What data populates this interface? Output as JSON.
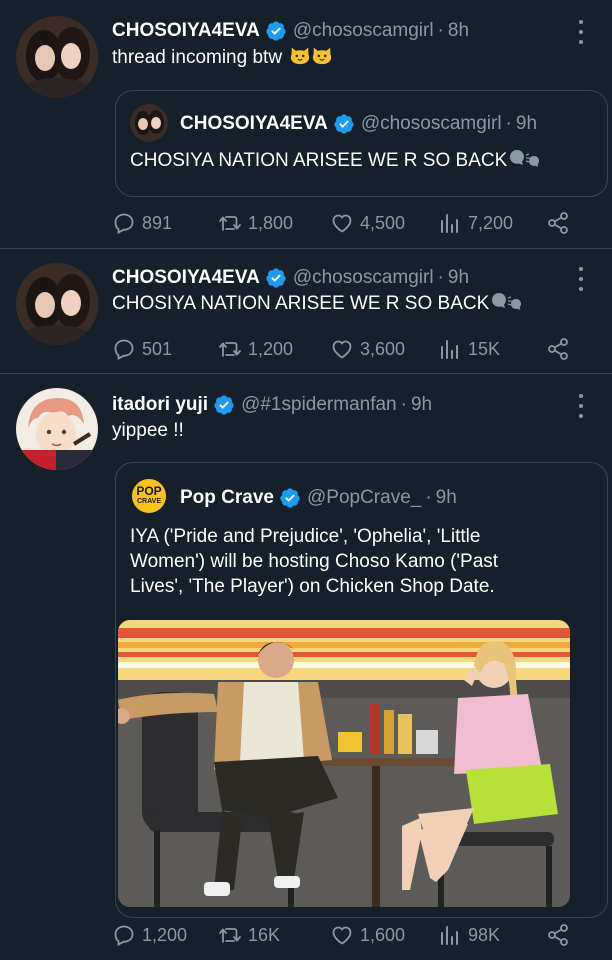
{
  "tweets": [
    {
      "name": "CHOSOIYA4EVA",
      "handle": "@chososcamgirl",
      "sep": "·",
      "time": "8h",
      "text": "thread incoming btw",
      "quote": {
        "name": "CHOSOIYA4EVA",
        "handle": "@chososcamgirl",
        "time": "9h",
        "text": "CHOSIYA NATION ARISEE WE R SO BACK"
      },
      "stats": {
        "replies": "891",
        "retweets": "1,800",
        "likes": "4,500",
        "views": "7,200"
      }
    },
    {
      "name": "CHOSOIYA4EVA",
      "handle": "@chososcamgirl",
      "sep": "·",
      "time": "9h",
      "text": "CHOSIYA NATION ARISEE WE R SO BACK",
      "stats": {
        "replies": "501",
        "retweets": "1,200",
        "likes": "3,600",
        "views": "15K"
      }
    },
    {
      "name": "itadori yuji",
      "handle": "@#1spidermanfan",
      "sep": "·",
      "time": "9h",
      "text": "yippee !!",
      "quote": {
        "name": "Pop Crave",
        "handle": "@PopCrave_",
        "time": "9h",
        "logo_line1": "POP",
        "logo_line2": "CRAVE",
        "text_line1": "IYA ('Pride and Prejudice', 'Ophelia', 'Little",
        "text_line2": "Women') will be hosting Choso Kamo ('Past",
        "text_line3": "Lives', 'The Player') on Chicken Shop Date."
      },
      "stats": {
        "replies": "1,200",
        "retweets": "16K",
        "likes": "1,600",
        "views": "98K"
      }
    }
  ],
  "colors": {
    "background": "#15202b",
    "border": "#38444d",
    "muted": "#8899a6",
    "verified": "#1d9bf0",
    "text": "#ffffff"
  }
}
